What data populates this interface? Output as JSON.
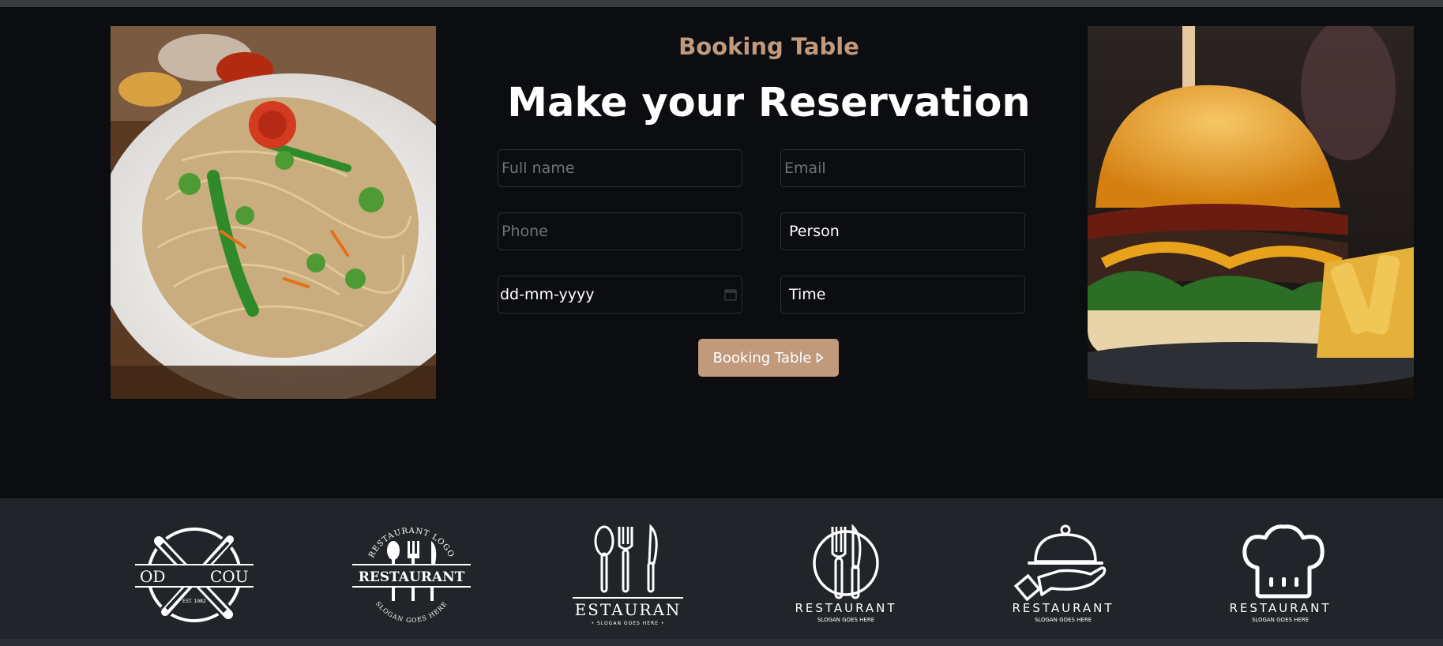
{
  "booking": {
    "eyebrow": "Booking Table",
    "heading": "Make your Reservation",
    "fields": {
      "full_name_placeholder": "Full name",
      "email_placeholder": "Email",
      "phone_placeholder": "Phone",
      "person_value": "Person",
      "date_value": "dd-mm-yyyy",
      "time_value": "Time"
    },
    "button_label": "Booking Table"
  },
  "images": {
    "left": "noodles-photo",
    "right": "burger-photo"
  },
  "logos": [
    {
      "icon": "crossed-fork-knife-icon",
      "left_text": "OD",
      "right_text": "COU",
      "small_text": "EST. 1982"
    },
    {
      "icon": "spoon-fork-knife-icon",
      "arc_top": "RESTAURANT LOGO",
      "main_text": "RESTAURANT",
      "arc_bottom": "SLOGAN GOES HERE"
    },
    {
      "icon": "spoon-fork-knife-icon",
      "main_text": "ESTAURAN",
      "small_text": "• SLOGAN GOES HERE •"
    },
    {
      "icon": "plate-fork-knife-icon",
      "main_text": "RESTAURANT",
      "small_text": "SLOGAN GOES HERE"
    },
    {
      "icon": "cloche-hand-icon",
      "main_text": "RESTAURANT",
      "small_text": "SLOGAN GOES HERE"
    },
    {
      "icon": "chef-hat-icon",
      "main_text": "RESTAURANT",
      "small_text": "SLOGAN GOES HERE"
    }
  ],
  "colors": {
    "background": "#0b0d10",
    "accent": "#c19a7c",
    "logo_strip": "#212429"
  }
}
